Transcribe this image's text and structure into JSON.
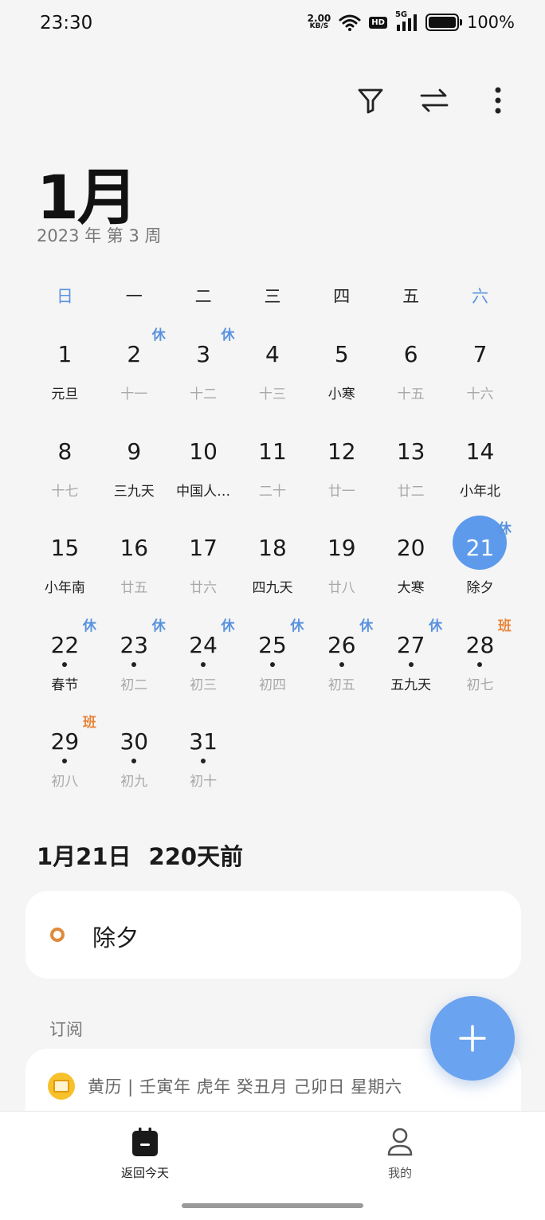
{
  "status_bar": {
    "time": "23:30",
    "net_speed_value": "2.00",
    "net_speed_unit": "KB/S",
    "hd_badge": "HD",
    "network_type": "5G",
    "battery_level": 100,
    "battery_percent": "100%"
  },
  "toolbar": {
    "icons": [
      "filter-icon",
      "swap-icon",
      "more-vertical-icon"
    ]
  },
  "header": {
    "month": "1月",
    "year_week": "2023 年 第 3 周"
  },
  "weekdays": [
    "日",
    "一",
    "二",
    "三",
    "四",
    "五",
    "六"
  ],
  "weeks": [
    [
      {
        "day": "1",
        "lunar": "元旦",
        "dim": false
      },
      {
        "day": "2",
        "lunar": "十一",
        "dim": true,
        "tag": "休",
        "tag_type": "rest"
      },
      {
        "day": "3",
        "lunar": "十二",
        "dim": true,
        "tag": "休",
        "tag_type": "rest"
      },
      {
        "day": "4",
        "lunar": "十三",
        "dim": true
      },
      {
        "day": "5",
        "lunar": "小寒",
        "dim": false
      },
      {
        "day": "6",
        "lunar": "十五",
        "dim": true
      },
      {
        "day": "7",
        "lunar": "十六",
        "dim": true
      }
    ],
    [
      {
        "day": "8",
        "lunar": "十七",
        "dim": true
      },
      {
        "day": "9",
        "lunar": "三九天",
        "dim": false
      },
      {
        "day": "10",
        "lunar": "中国人…",
        "dim": false
      },
      {
        "day": "11",
        "lunar": "二十",
        "dim": true
      },
      {
        "day": "12",
        "lunar": "廿一",
        "dim": true
      },
      {
        "day": "13",
        "lunar": "廿二",
        "dim": true
      },
      {
        "day": "14",
        "lunar": "小年北",
        "dim": false
      }
    ],
    [
      {
        "day": "15",
        "lunar": "小年南",
        "dim": false
      },
      {
        "day": "16",
        "lunar": "廿五",
        "dim": true
      },
      {
        "day": "17",
        "lunar": "廿六",
        "dim": true
      },
      {
        "day": "18",
        "lunar": "四九天",
        "dim": false
      },
      {
        "day": "19",
        "lunar": "廿八",
        "dim": true
      },
      {
        "day": "20",
        "lunar": "大寒",
        "dim": false
      },
      {
        "day": "21",
        "lunar": "除夕",
        "dim": false,
        "selected": true,
        "tag": "休",
        "tag_type": "rest"
      }
    ],
    [
      {
        "day": "22",
        "lunar": "春节",
        "dim": false,
        "dot": true,
        "tag": "休",
        "tag_type": "rest"
      },
      {
        "day": "23",
        "lunar": "初二",
        "dim": true,
        "dot": true,
        "tag": "休",
        "tag_type": "rest"
      },
      {
        "day": "24",
        "lunar": "初三",
        "dim": true,
        "dot": true,
        "tag": "休",
        "tag_type": "rest"
      },
      {
        "day": "25",
        "lunar": "初四",
        "dim": true,
        "dot": true,
        "tag": "休",
        "tag_type": "rest"
      },
      {
        "day": "26",
        "lunar": "初五",
        "dim": true,
        "dot": true,
        "tag": "休",
        "tag_type": "rest"
      },
      {
        "day": "27",
        "lunar": "五九天",
        "dim": false,
        "dot": true,
        "tag": "休",
        "tag_type": "rest"
      },
      {
        "day": "28",
        "lunar": "初七",
        "dim": true,
        "dot": true,
        "tag": "班",
        "tag_type": "work"
      }
    ],
    [
      {
        "day": "29",
        "lunar": "初八",
        "dim": true,
        "dot": true,
        "tag": "班",
        "tag_type": "work"
      },
      {
        "day": "30",
        "lunar": "初九",
        "dim": true,
        "dot": true
      },
      {
        "day": "31",
        "lunar": "初十",
        "dim": true,
        "dot": true
      }
    ]
  ],
  "selected_date": {
    "date": "1月21日",
    "relative": "220天前"
  },
  "event": {
    "title": "除夕",
    "color": "#e08a3c"
  },
  "subscription": {
    "label": "订阅",
    "almanac_text": "黄历 | 壬寅年 虎年 癸丑月 己卯日 星期六"
  },
  "bottom_nav": {
    "today_label": "返回今天",
    "mine_label": "我的"
  },
  "colors": {
    "accent": "#5e9aec",
    "rest_tag": "#5a93dd",
    "work_tag": "#e8853b"
  }
}
